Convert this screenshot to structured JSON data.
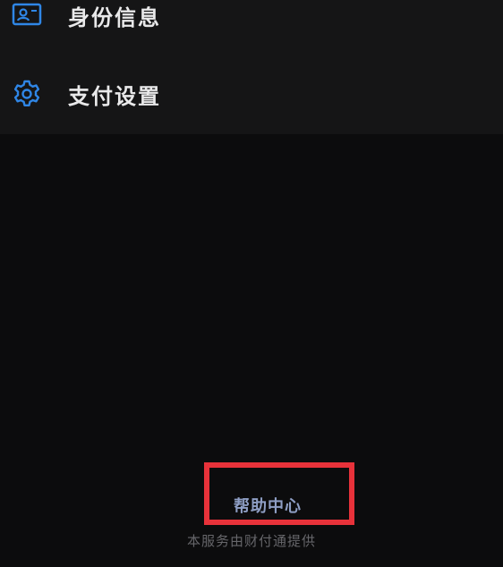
{
  "menu": {
    "items": [
      {
        "label": "身份信息",
        "icon": "id-card-icon"
      },
      {
        "label": "支付设置",
        "icon": "gear-icon"
      }
    ]
  },
  "footer": {
    "help_label": "帮助中心",
    "provider_note": "本服务由财付通提供"
  },
  "colors": {
    "background": "#0c0c0d",
    "panel": "#151516",
    "icon_accent": "#2f86e6",
    "highlight": "#e8323a",
    "help_text": "#8e9ec4"
  }
}
